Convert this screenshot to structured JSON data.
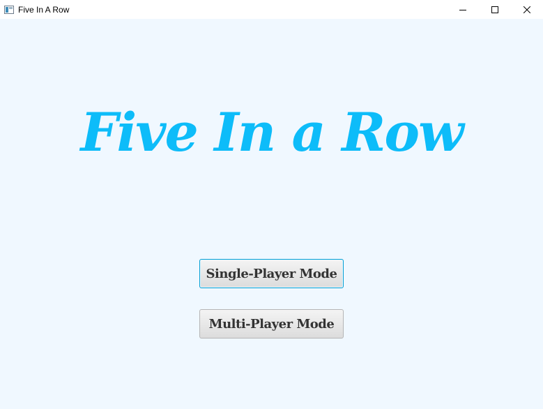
{
  "window": {
    "title": "Five In A Row",
    "controls": {
      "minimize_icon": "minimize-icon",
      "maximize_icon": "maximize-icon",
      "close_icon": "close-icon"
    }
  },
  "main": {
    "title": "Five In a Row",
    "buttons": {
      "single_player": "Single-Player Mode",
      "multi_player": "Multi-Player Mode"
    }
  },
  "colors": {
    "background": "#f0f8ff",
    "title": "#0dbcf9",
    "focus_border": "#039ed3",
    "button_text": "#333333"
  }
}
